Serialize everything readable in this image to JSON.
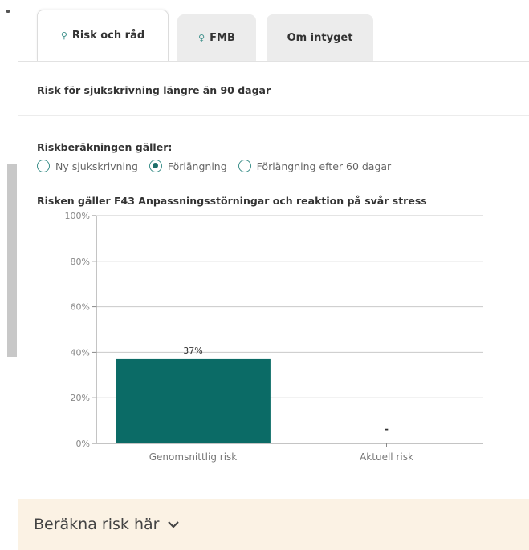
{
  "tabs": [
    {
      "label": "Risk och råd",
      "icon": "lightbulb-icon",
      "active": true
    },
    {
      "label": "FMB",
      "icon": "lightbulb-icon",
      "active": false
    },
    {
      "label": "Om intyget",
      "icon": "",
      "active": false
    }
  ],
  "risk_title": "Risk för sjukskrivning längre än 90 dagar",
  "calc_label": "Riskberäkningen gäller:",
  "radio_options": [
    {
      "label": "Ny sjukskrivning",
      "checked": false
    },
    {
      "label": "Förlängning",
      "checked": true
    },
    {
      "label": "Förlängning efter 60 dagar",
      "checked": false
    }
  ],
  "diagnosis_title": "Risken gäller F43 Anpassningsstörningar och reaktion på svår stress",
  "chart_data": {
    "type": "bar",
    "categories": [
      "Genomsnittlig risk",
      "Aktuell risk"
    ],
    "values": [
      37,
      null
    ],
    "data_labels": [
      "37%",
      "-"
    ],
    "y_ticks": [
      "0%",
      "20%",
      "40%",
      "60%",
      "80%",
      "100%"
    ],
    "ylim": [
      0,
      100
    ],
    "bar_color": "#0b6b66",
    "grid": true
  },
  "footer": {
    "label": "Beräkna risk här"
  },
  "colors": {
    "accent": "#3c8f8a",
    "footer_bg": "#fbf2e4"
  }
}
